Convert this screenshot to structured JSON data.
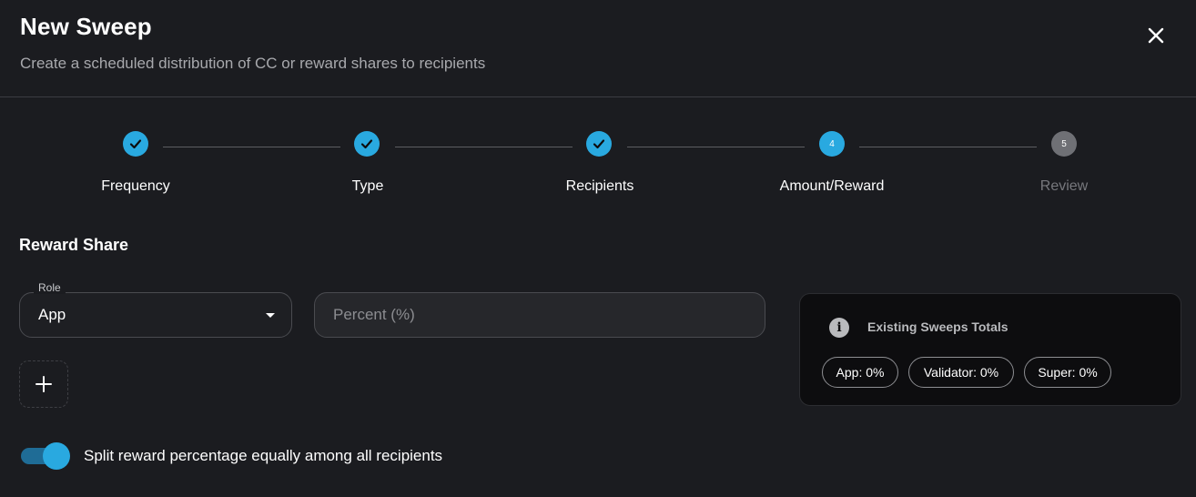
{
  "dialog": {
    "title": "New Sweep",
    "subtitle": "Create a scheduled distribution of CC or reward shares to recipients",
    "close_icon": "close-icon"
  },
  "stepper": {
    "steps": [
      {
        "label": "Frequency",
        "state": "done",
        "marker": ""
      },
      {
        "label": "Type",
        "state": "done",
        "marker": ""
      },
      {
        "label": "Recipients",
        "state": "done",
        "marker": ""
      },
      {
        "label": "Amount/Reward",
        "state": "active",
        "marker": "4"
      },
      {
        "label": "Review",
        "state": "future",
        "marker": "5"
      }
    ],
    "accent_color": "#29a9e0"
  },
  "form": {
    "section_title": "Reward Share",
    "role": {
      "label": "Role",
      "value": "App"
    },
    "percent": {
      "placeholder": "Percent (%)",
      "value": ""
    },
    "add_icon": "plus-icon",
    "split_toggle": {
      "on": true,
      "label": "Split reward percentage equally among all recipients"
    }
  },
  "totals": {
    "title": "Existing Sweeps Totals",
    "icon": "info-icon",
    "chips": [
      "App: 0%",
      "Validator: 0%",
      "Super: 0%"
    ]
  }
}
